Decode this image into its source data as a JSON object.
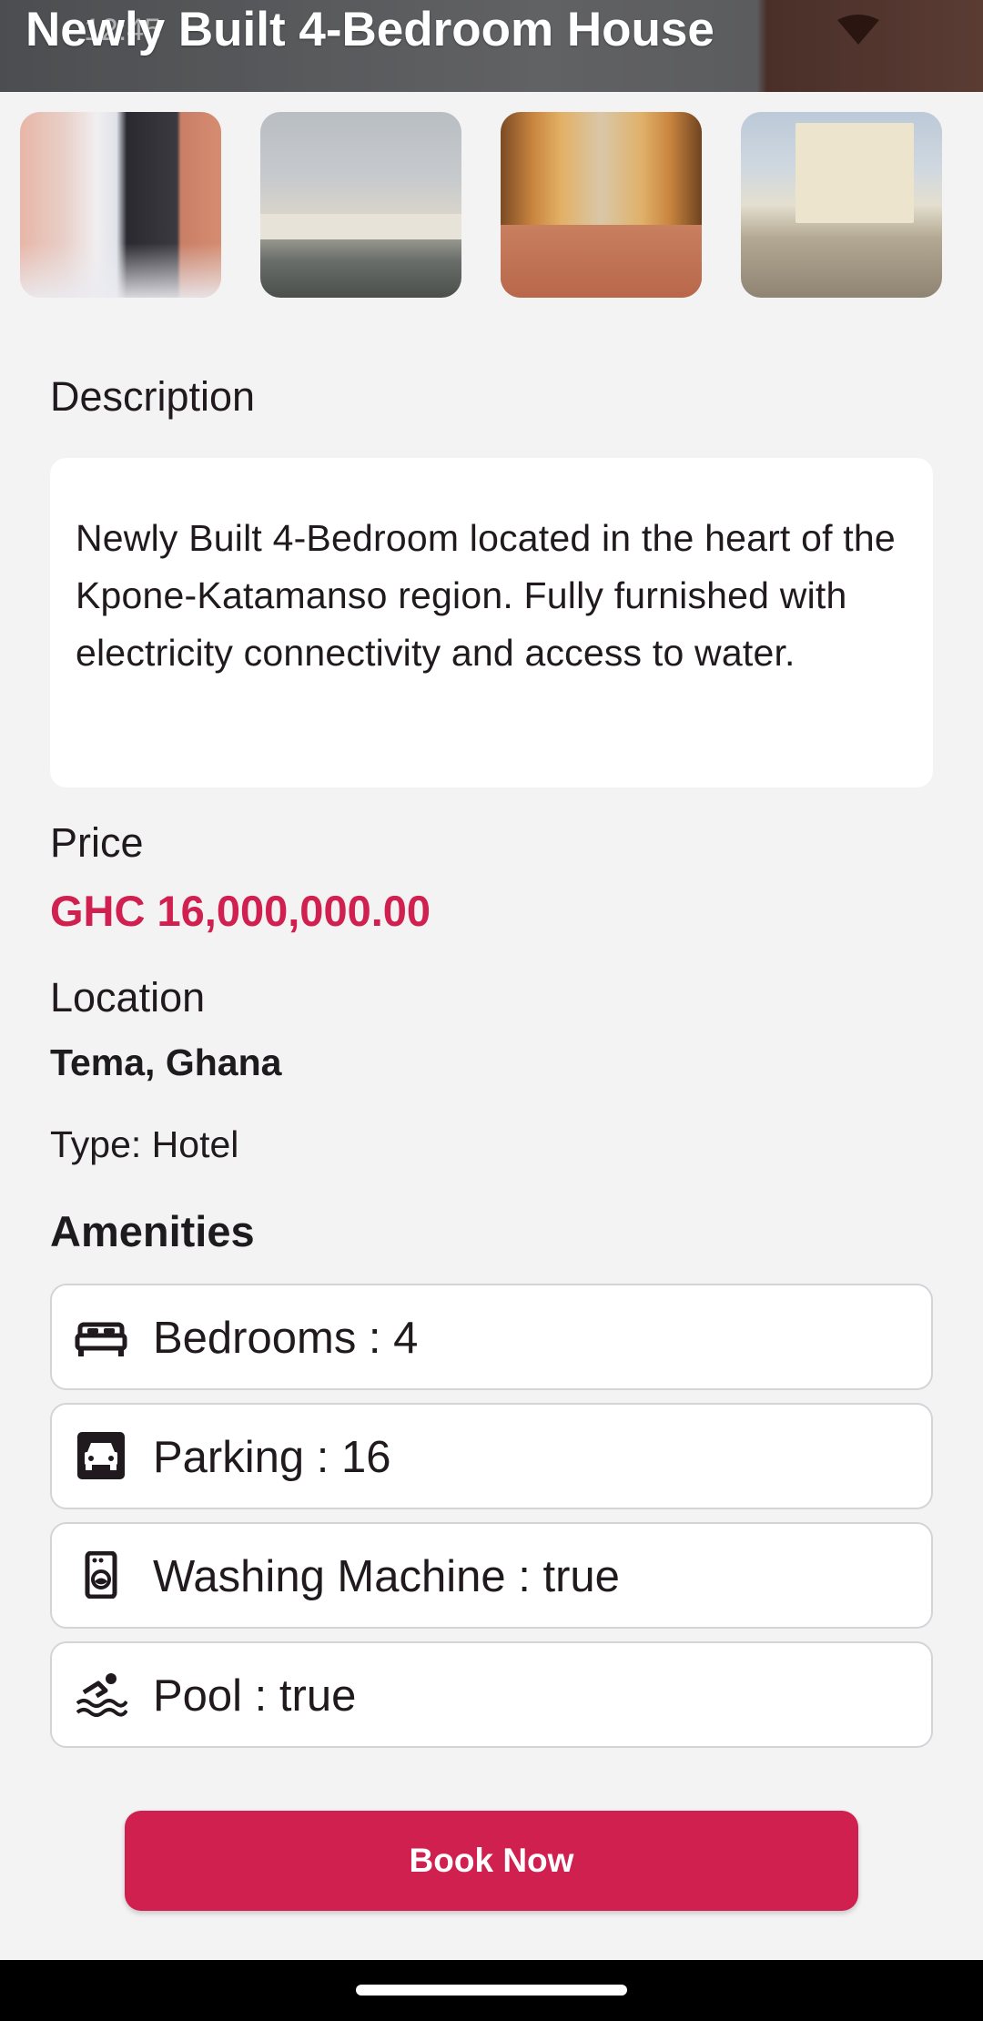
{
  "status_bar": {
    "time": "12:45"
  },
  "app_bar": {
    "title": "Newly Built 4-Bedroom House"
  },
  "gallery": {
    "images": [
      {
        "alt": "interior-hallway"
      },
      {
        "alt": "street-view"
      },
      {
        "alt": "balcony-arches"
      },
      {
        "alt": "house-exterior"
      }
    ]
  },
  "description": {
    "label": "Description",
    "text": "Newly Built 4-Bedroom located in the heart of the Kpone-Katamanso region. Fully furnished with electricity connectivity and access to water."
  },
  "price": {
    "label": "Price",
    "value": "GHC 16,000,000.00",
    "color": "#d0204f"
  },
  "location": {
    "label": "Location",
    "value": "Tema, Ghana"
  },
  "type": {
    "text": "Type: Hotel"
  },
  "amenities": {
    "heading": "Amenities",
    "items": [
      {
        "icon": "bed-icon",
        "label": "Bedrooms : 4"
      },
      {
        "icon": "car-icon",
        "label": "Parking : 16"
      },
      {
        "icon": "washing-machine-icon",
        "label": "Washing Machine : true"
      },
      {
        "icon": "pool-icon",
        "label": "Pool : true"
      }
    ]
  },
  "actions": {
    "book_label": "Book Now",
    "accent": "#d0204f"
  }
}
